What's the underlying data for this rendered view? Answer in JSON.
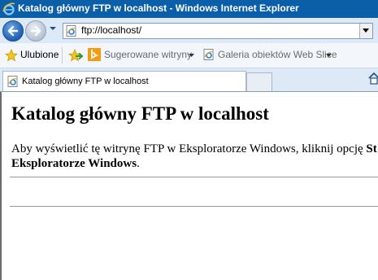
{
  "window": {
    "title": "Katalog główny FTP w localhost - Windows Internet Explorer"
  },
  "address_bar": {
    "url": "ftp://localhost/"
  },
  "favorites_bar": {
    "favorites_label": "Ulubione",
    "suggested_sites_label": "Sugerowane witryny",
    "web_slice_gallery_label": "Galeria obiektów Web Slice"
  },
  "tabs": [
    {
      "label": "Katalog główny FTP w localhost"
    }
  ],
  "content": {
    "heading": "Katalog główny FTP w localhost",
    "paragraph_line1_text": "Aby wyświetlić tę witrynę FTP w Eksploratorze Windows, kliknij opcję ",
    "paragraph_line1_bold": "St",
    "paragraph_line2_bold": "Eksploratorze Windows",
    "paragraph_line2_text": "."
  }
}
